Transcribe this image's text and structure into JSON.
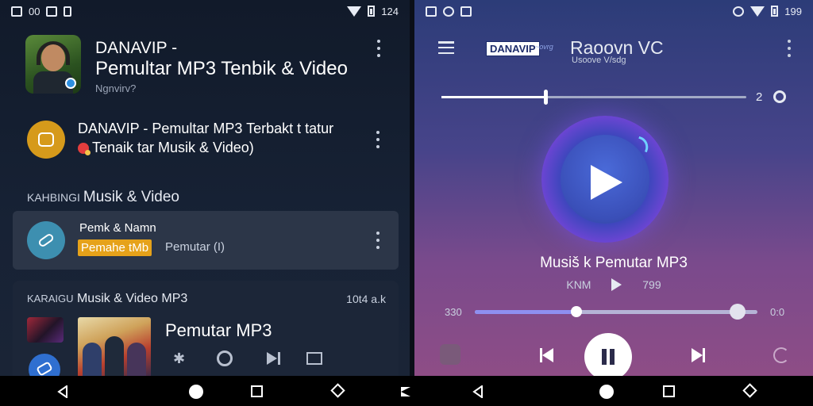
{
  "left_status": {
    "time": "00",
    "right": "124"
  },
  "right_status": {
    "right": "199"
  },
  "left_header": {
    "title": "DANAVIP -",
    "subtitle": "Pemultar MP3  Tenbik & Video",
    "small": "Ngnvirv?"
  },
  "list": {
    "row1_title": "DANAVIP - Pemultar MP3 Terbakt t tatur",
    "row1_sub": "Tenaik tar  Musik & Video)",
    "section_pre": "KAHBINGI",
    "section_title": "Musik & Video",
    "card_title": "Pemk & Namn",
    "card_tag": "Pemahe tMb",
    "card_meta": "Pemutar (I)"
  },
  "card2": {
    "head_pre": "KARAIGU",
    "head": "Musik & Video MP3",
    "right": "10t4 a.k",
    "title": "Pemutar MP3"
  },
  "player": {
    "brand_box": "DANAVIP",
    "brand_tag": "~ovrg",
    "brand_title": "Raoovn VC",
    "brand_sub": "Usoove V/sdg",
    "top_slider_value": 0.34,
    "top_number": "2",
    "song_title": "Musiš k Pemutar MP3",
    "meta_left": "KNM",
    "meta_right": "799",
    "time_start": "330",
    "time_end": "0:0",
    "progress": 0.36,
    "progress_end_knob": 0.93
  },
  "icons": {
    "status_photo": "photo-icon",
    "wifi": "wifi-icon",
    "battery": "battery-icon",
    "menu": "menu-icon",
    "play": "play-icon",
    "pause": "pause-icon",
    "prev": "skip-previous-icon",
    "next": "skip-next-icon"
  },
  "colors": {
    "accent_orange": "#e6a21a",
    "accent_blue": "#3d8fb0",
    "left_bg": "#111a2a",
    "right_bg": "#47448a"
  }
}
